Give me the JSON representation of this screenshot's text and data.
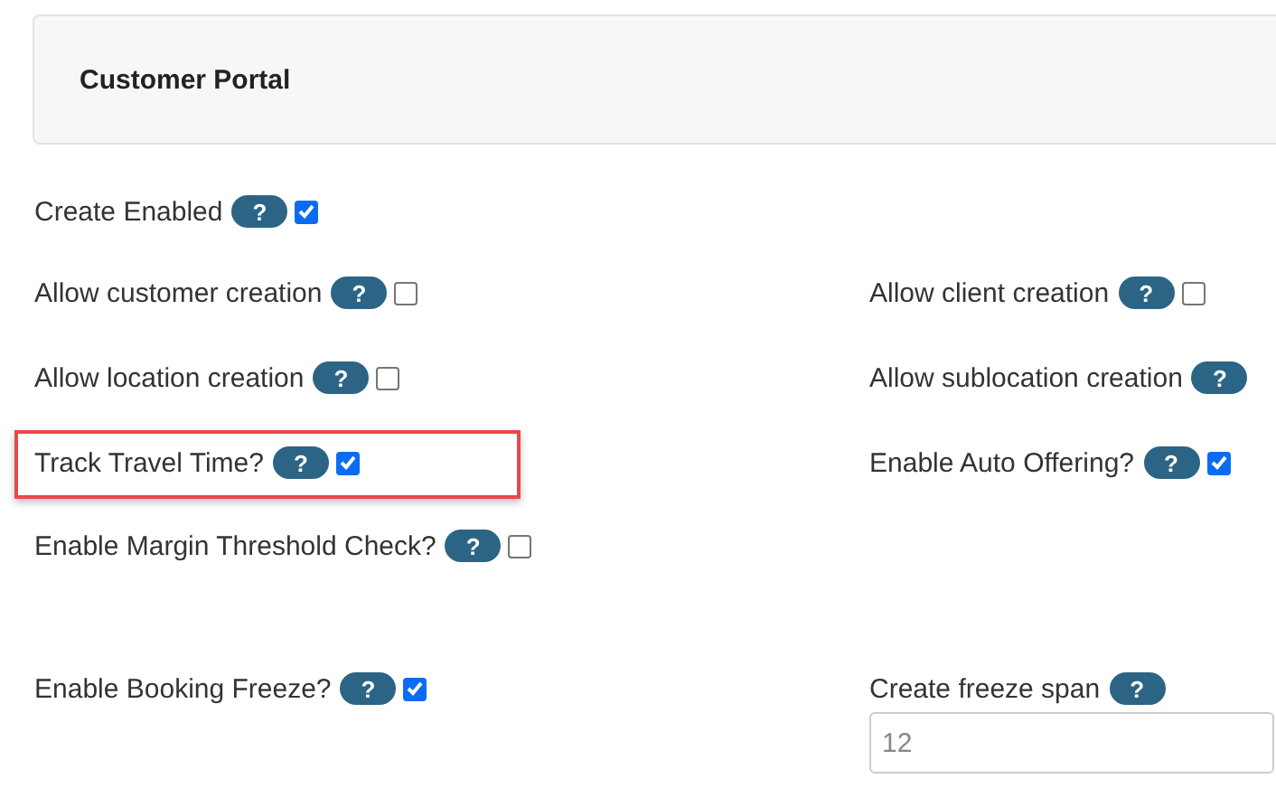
{
  "panel": {
    "title": "Customer Portal"
  },
  "rows": [
    {
      "left": {
        "label": "Create Enabled",
        "help": "?",
        "checked": true,
        "highlighted": false
      }
    },
    {
      "left": {
        "label": "Allow customer creation",
        "help": "?",
        "checked": false,
        "highlighted": false
      },
      "right": {
        "label": "Allow client creation",
        "help": "?",
        "checked": false,
        "highlighted": false
      }
    },
    {
      "left": {
        "label": "Allow location creation",
        "help": "?",
        "checked": false,
        "highlighted": false
      },
      "right": {
        "label": "Allow sublocation creation",
        "help": "?",
        "highlighted": false
      }
    },
    {
      "left": {
        "label": "Track Travel Time?",
        "help": "?",
        "checked": true,
        "highlighted": true
      },
      "right": {
        "label": "Enable Auto Offering?",
        "help": "?",
        "checked": true,
        "highlighted": false
      }
    },
    {
      "left": {
        "label": "Enable Margin Threshold Check?",
        "help": "?",
        "checked": false,
        "highlighted": false
      }
    },
    {
      "left": {
        "label": "Enable Booking Freeze?",
        "help": "?",
        "checked": true,
        "highlighted": false
      },
      "right": {
        "label": "Create freeze span",
        "help": "?",
        "placeholder": "12",
        "highlighted": false
      }
    }
  ]
}
